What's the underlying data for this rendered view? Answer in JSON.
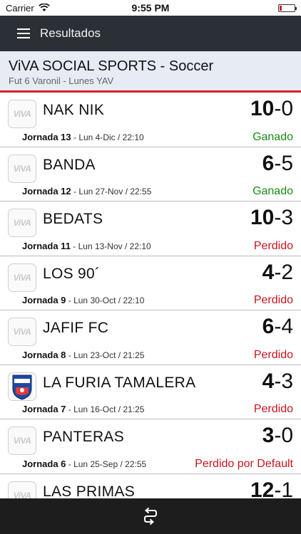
{
  "status": {
    "carrier": "Carrier",
    "time": "9:55 PM",
    "battery_level": 0.15
  },
  "nav": {
    "title": "Resultados",
    "menu_icon": "hamburger-menu-icon"
  },
  "header": {
    "title": "ViVA SOCIAL SPORTS - Soccer",
    "subtitle": "Fut 6 Varonil - Lunes YAV"
  },
  "colors": {
    "win": "#1a8c1a",
    "loss": "#c8141e",
    "accent": "#d8202c",
    "navbar": "#2b3036"
  },
  "matches": [
    {
      "team": "NAK NIK",
      "score_home": "10",
      "sep": "-",
      "score_away": "0",
      "jornada": "Jornada 13",
      "date": " - Lun 4-Dic / 22:10",
      "result": "Ganado",
      "logo": "viva"
    },
    {
      "team": "BANDA",
      "score_home": "6",
      "sep": "-",
      "score_away": "5",
      "jornada": "Jornada 12",
      "date": " - Lun 27-Nov / 22:55",
      "result": "Ganado",
      "logo": "viva"
    },
    {
      "team": "BEDATS",
      "score_home": "10",
      "sep": "-",
      "score_away": "3",
      "jornada": "Jornada 11",
      "date": " - Lun 13-Nov / 22:10",
      "result": "Perdido",
      "logo": "viva"
    },
    {
      "team": "LOS 90´",
      "score_home": "4",
      "sep": "-",
      "score_away": "2",
      "jornada": "Jornada 9",
      "date": " - Lun 30-Oct / 22:10",
      "result": "Perdido",
      "logo": "viva"
    },
    {
      "team": "JAFIF FC",
      "score_home": "6",
      "sep": "-",
      "score_away": "4",
      "jornada": "Jornada 8",
      "date": " - Lun 23-Oct / 21:25",
      "result": "Perdido",
      "logo": "viva"
    },
    {
      "team": "LA FURIA TAMALERA",
      "score_home": "4",
      "sep": "-",
      "score_away": "3",
      "jornada": "Jornada 7",
      "date": " - Lun 16-Oct / 21:25",
      "result": "Perdido",
      "logo": "crest",
      "logo_text": "TAMALERA"
    },
    {
      "team": "PANTERAS",
      "score_home": "3",
      "sep": "-",
      "score_away": "0",
      "jornada": "Jornada 6",
      "date": " - Lun 25-Sep / 22:55",
      "result": "Perdido por Default",
      "logo": "viva"
    },
    {
      "team": "LAS PRIMAS",
      "score_home": "12",
      "sep": "-",
      "score_away": "1",
      "jornada": "",
      "date": "",
      "result": "",
      "logo": "viva"
    }
  ],
  "logo_text": "ViVA",
  "bottom": {
    "icon": "back-arrow-icon"
  }
}
